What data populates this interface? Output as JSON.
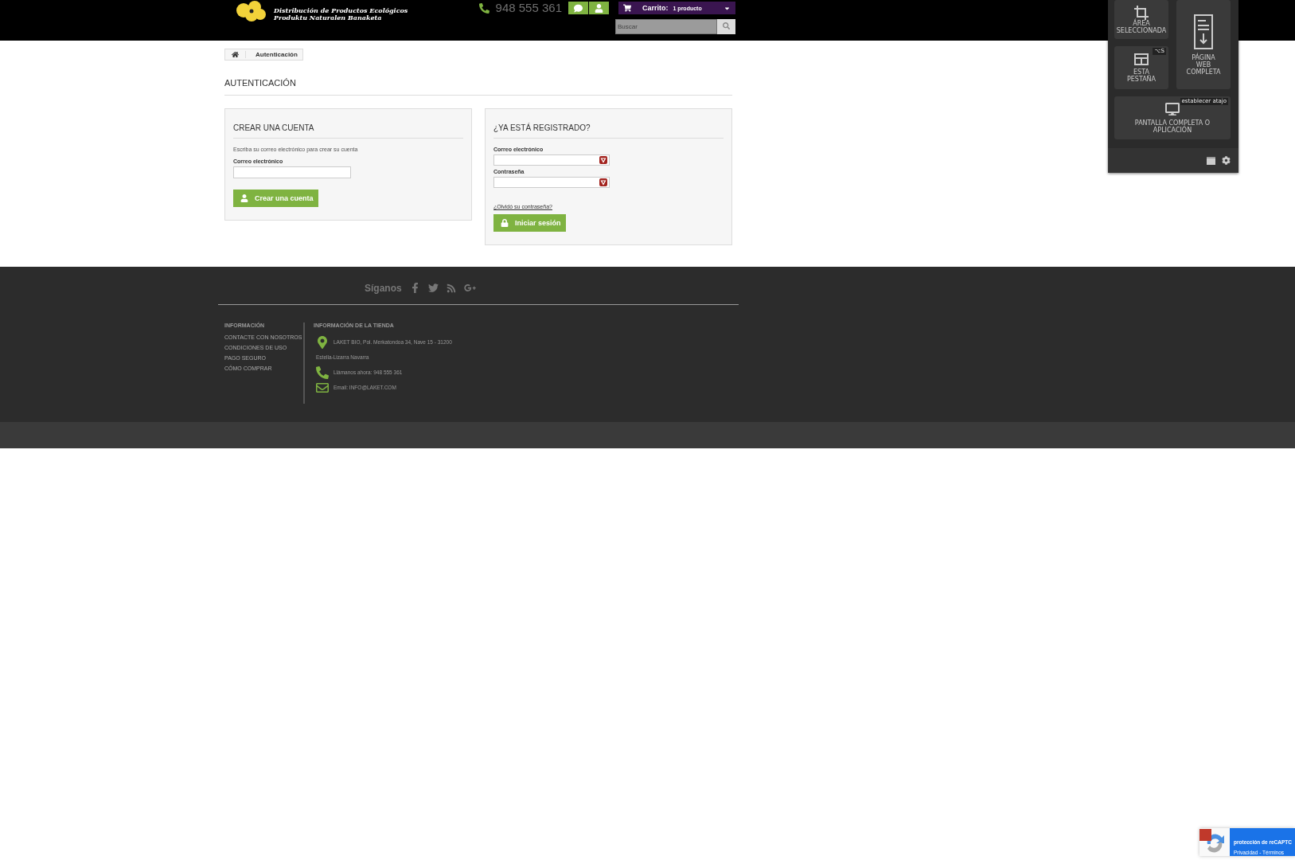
{
  "header": {
    "logo_subtitle": [
      "Distribución de Productos Ecológicos",
      "Produktu Naturalen Banaketa"
    ],
    "phone": "948 555 361",
    "cart": {
      "label": "Carrito:",
      "count": "1 producto"
    },
    "search": {
      "placeholder": "Buscar"
    }
  },
  "breadcrumb": {
    "current": "Autenticación"
  },
  "page_title": "AUTENTICACIÓN",
  "create_account": {
    "title": "CREAR UNA CUENTA",
    "intro": "Escriba su correo electrónico para crear su cuenta",
    "email_label": "Correo electrónico",
    "button": "Crear una cuenta"
  },
  "login": {
    "title": "¿YA ESTÁ REGISTRADO?",
    "email_label": "Correo electrónico",
    "password_label": "Contraseña",
    "forgot_link": "¿Olvidó su contraseña?",
    "button": "Iniciar sesión"
  },
  "footer": {
    "follow": "Síganos",
    "info_title": "INFORMACIÓN",
    "info_links": [
      "CONTACTE CON NOSOTROS",
      "CONDICIONES DE USO",
      "PAGO SEGURO",
      "CÓMO COMPRAR"
    ],
    "store_title": "INFORMACIÓN DE LA TIENDA",
    "store_lines": [
      {
        "kind": "address",
        "text": "LAKET BIO, Pol. Merkatondoa 34, Nave 15 - 31200"
      },
      {
        "kind": "plain",
        "text": "Estella-Lizarra Navarra"
      },
      {
        "kind": "phone",
        "text": "Llámanos ahora: 948 555 361"
      },
      {
        "kind": "email",
        "text": "Email: INFO@LAKET.COM"
      }
    ]
  },
  "capture_panel": {
    "area": [
      "ÁREA",
      "SELECCIONADA"
    ],
    "tab": [
      "ESTA",
      "PESTAÑA"
    ],
    "tab_shortcut": "⌥S",
    "full_page": [
      "PÁGINA",
      "WEB",
      "COMPLETA"
    ],
    "screen_shortcut": "establecer atajo",
    "screen": [
      "PANTALLA COMPLETA O",
      "APLICACIÓN"
    ]
  },
  "recaptcha": {
    "title": "protección de reCAPTC",
    "links": "Privacidad - Términos"
  }
}
